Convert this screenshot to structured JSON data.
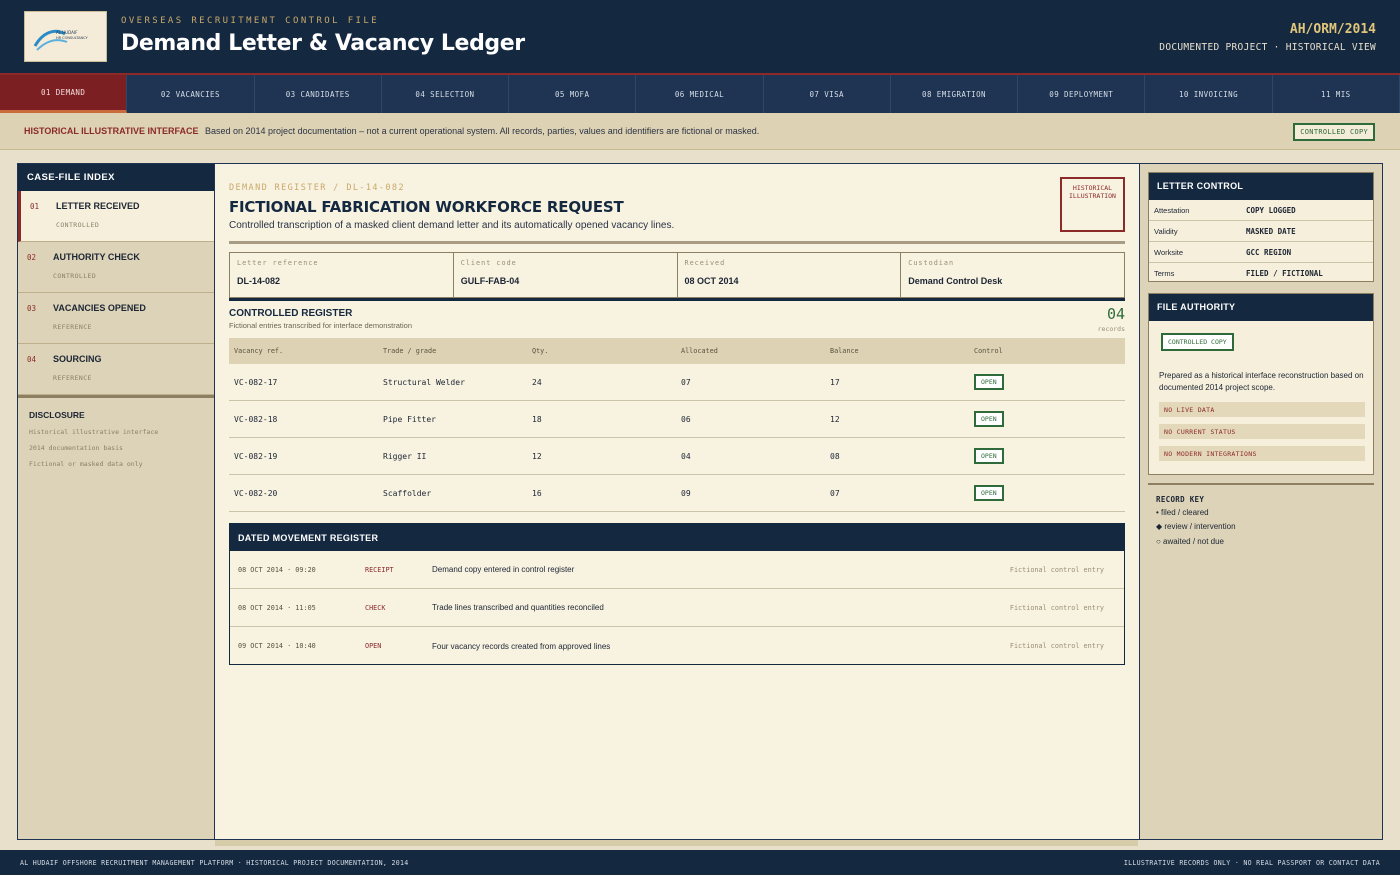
{
  "header": {
    "kicker": "OVERSEAS RECRUITMENT CONTROL FILE",
    "title": "Demand Letter & Vacancy Ledger",
    "file_code": "AH/ORM/2014",
    "subtitle": "DOCUMENTED PROJECT · HISTORICAL VIEW",
    "logo_text_1": "AL HUDAIF",
    "logo_text_2": "HR CONSULTANCY"
  },
  "tabs": [
    {
      "label": "01 DEMAND",
      "active": true
    },
    {
      "label": "02 VACANCIES"
    },
    {
      "label": "03 CANDIDATES"
    },
    {
      "label": "04 SELECTION"
    },
    {
      "label": "05 MOFA"
    },
    {
      "label": "06 MEDICAL"
    },
    {
      "label": "07 VISA"
    },
    {
      "label": "08 EMIGRATION"
    },
    {
      "label": "09 DEPLOYMENT"
    },
    {
      "label": "10 INVOICING"
    },
    {
      "label": "11 MIS"
    }
  ],
  "banner": {
    "tag": "HISTORICAL ILLUSTRATIVE INTERFACE",
    "text": "Based on 2014 project documentation – not a current operational system. All records, parties, values and identifiers are fictional or masked.",
    "badge": "CONTROLLED COPY"
  },
  "sidebar": {
    "heading": "CASE-FILE INDEX",
    "items": [
      {
        "num": "01",
        "label": "LETTER RECEIVED",
        "status": "CONTROLLED"
      },
      {
        "num": "02",
        "label": "AUTHORITY CHECK",
        "status": "CONTROLLED"
      },
      {
        "num": "03",
        "label": "VACANCIES OPENED",
        "status": "REFERENCE"
      },
      {
        "num": "04",
        "label": "SOURCING",
        "status": "REFERENCE"
      }
    ],
    "disclosure": {
      "heading": "DISCLOSURE",
      "lines": [
        "Historical illustrative interface",
        "2014 documentation basis",
        "Fictional or masked data only"
      ]
    }
  },
  "main": {
    "kicker": "DEMAND REGISTER / DL-14-082",
    "title": "FICTIONAL FABRICATION WORKFORCE REQUEST",
    "subtitle": "Controlled transcription of a masked client demand letter and its automatically opened vacancy lines.",
    "stamp": "HISTORICAL ILLUSTRATION",
    "meta": [
      {
        "label": "Letter reference",
        "value": "DL-14-082"
      },
      {
        "label": "Client code",
        "value": "GULF-FAB-04"
      },
      {
        "label": "Received",
        "value": "08 OCT 2014"
      },
      {
        "label": "Custodian",
        "value": "Demand Control Desk"
      }
    ],
    "register": {
      "title": "CONTROLLED REGISTER",
      "subtitle": "Fictional entries transcribed for interface demonstration",
      "count": "04",
      "count_label": "records",
      "columns": [
        "Vacancy ref.",
        "Trade / grade",
        "Qty.",
        "Allocated",
        "Balance",
        "Control"
      ],
      "rows": [
        {
          "ref": "VC-082-17",
          "trade": "Structural Welder",
          "qty": "24",
          "allocated": "07",
          "balance": "17",
          "control": "OPEN"
        },
        {
          "ref": "VC-082-18",
          "trade": "Pipe Fitter",
          "qty": "18",
          "allocated": "06",
          "balance": "12",
          "control": "OPEN"
        },
        {
          "ref": "VC-082-19",
          "trade": "Rigger II",
          "qty": "12",
          "allocated": "04",
          "balance": "08",
          "control": "OPEN"
        },
        {
          "ref": "VC-082-20",
          "trade": "Scaffolder",
          "qty": "16",
          "allocated": "09",
          "balance": "07",
          "control": "OPEN"
        }
      ]
    },
    "movements": {
      "title": "DATED MOVEMENT REGISTER",
      "rows": [
        {
          "time": "08 OCT 2014 · 09:20",
          "type": "RECEIPT",
          "text": "Demand copy entered in control register",
          "note": "Fictional control entry"
        },
        {
          "time": "08 OCT 2014 · 11:05",
          "type": "CHECK",
          "text": "Trade lines transcribed and quantities reconciled",
          "note": "Fictional control entry"
        },
        {
          "time": "09 OCT 2014 · 10:40",
          "type": "OPEN",
          "text": "Four vacancy records created from approved lines",
          "note": "Fictional control entry"
        }
      ]
    }
  },
  "right": {
    "letter_control": {
      "heading": "LETTER CONTROL",
      "rows": [
        {
          "k": "Attestation",
          "v": "COPY LOGGED"
        },
        {
          "k": "Validity",
          "v": "MASKED DATE"
        },
        {
          "k": "Worksite",
          "v": "GCC REGION"
        },
        {
          "k": "Terms",
          "v": "FILED / FICTIONAL"
        }
      ]
    },
    "file_authority": {
      "heading": "FILE AUTHORITY",
      "badge": "CONTROLLED COPY",
      "text": "Prepared as a historical interface reconstruction based on documented 2014 project scope.",
      "chips": [
        "NO LIVE DATA",
        "NO CURRENT STATUS",
        "NO MODERN INTEGRATIONS"
      ]
    },
    "record_key": {
      "heading": "RECORD KEY",
      "items": [
        "• filed / cleared",
        "◆ review / intervention",
        "○ awaited / not due"
      ]
    }
  },
  "footer": {
    "left": "AL HUDAIF OFFSHORE RECRUITMENT MANAGEMENT PLATFORM · HISTORICAL PROJECT DOCUMENTATION, 2014",
    "right": "ILLUSTRATIVE RECORDS ONLY · NO REAL PASSPORT OR CONTACT DATA"
  }
}
